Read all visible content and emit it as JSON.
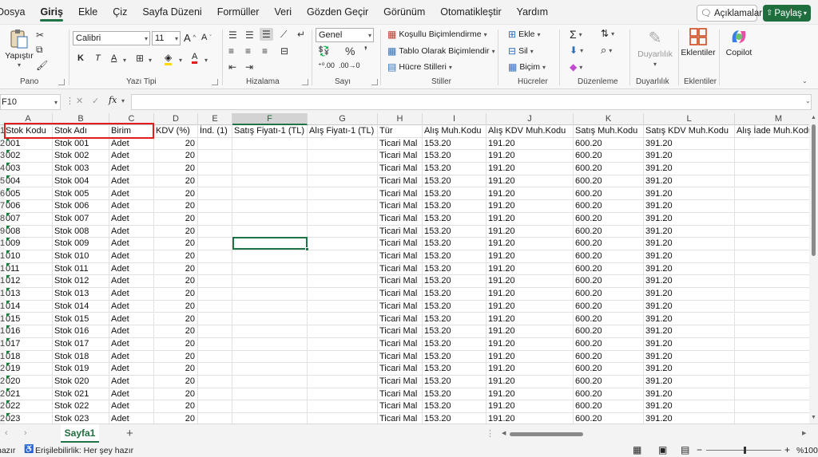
{
  "menu": {
    "items": [
      "Dosya",
      "Giriş",
      "Ekle",
      "Çiz",
      "Sayfa Düzeni",
      "Formüller",
      "Veri",
      "Gözden Geçir",
      "Görünüm",
      "Otomatikleştir",
      "Yardım"
    ],
    "active": "Giriş",
    "comments_label": "Açıklamalar",
    "share_label": "Paylaş"
  },
  "ribbon": {
    "clipboard": {
      "paste_label": "Yapıştır",
      "group_label": "Pano"
    },
    "font": {
      "font_name": "Calibri",
      "font_size": "11",
      "group_label": "Yazı Tipi",
      "bold": "K",
      "italic": "T",
      "underline": "A"
    },
    "alignment": {
      "group_label": "Hizalama"
    },
    "number": {
      "format": "Genel",
      "group_label": "Sayı"
    },
    "styles": {
      "conditional": "Koşullu Biçimlendirme",
      "as_table": "Tablo Olarak Biçimlendir",
      "cell_styles": "Hücre Stilleri",
      "group_label": "Stiller"
    },
    "cells": {
      "insert": "Ekle",
      "delete": "Sil",
      "format": "Biçim",
      "group_label": "Hücreler"
    },
    "editing": {
      "group_label": "Düzenleme"
    },
    "sensitivity": {
      "label": "Duyarlılık",
      "group_label": "Duyarlılık"
    },
    "addins": {
      "label": "Eklentiler",
      "group_label": "Eklentiler"
    },
    "copilot": {
      "label": "Copilot"
    }
  },
  "formula_bar": {
    "name_box": "F10",
    "fx": "fx",
    "value": ""
  },
  "columns": [
    {
      "letter": "A"
    },
    {
      "letter": "B"
    },
    {
      "letter": "C"
    },
    {
      "letter": "D"
    },
    {
      "letter": "E"
    },
    {
      "letter": "F"
    },
    {
      "letter": "G"
    },
    {
      "letter": "H"
    },
    {
      "letter": "I"
    },
    {
      "letter": "J"
    },
    {
      "letter": "K"
    },
    {
      "letter": "L"
    },
    {
      "letter": "M"
    }
  ],
  "selected_column": "F",
  "header_row": [
    "Stok Kodu",
    "Stok Adı",
    "Birim",
    "KDV (%)",
    "İnd. (1)",
    "Satış Fiyatı-1 (TL)",
    "Alış Fiyatı-1 (TL)",
    "Tür",
    "Alış Muh.Kodu",
    "Alış KDV Muh.Kodu",
    "Satış Muh.Kodu",
    "Satış KDV Muh.Kodu",
    "Alış İade Muh.Kodu"
  ],
  "row_numbers": [
    "1",
    "2",
    "3",
    "4",
    "5",
    "6",
    "7",
    "8",
    "9",
    "10",
    "11",
    "12",
    "13",
    "14",
    "15",
    "16",
    "17",
    "18",
    "19",
    "20",
    "21",
    "22",
    "23",
    "24"
  ],
  "rows": [
    [
      "001",
      "Stok 001",
      "Adet",
      "20",
      "",
      "",
      "",
      "Ticari Mal",
      "153.20",
      "191.20",
      "600.20",
      "391.20"
    ],
    [
      "002",
      "Stok 002",
      "Adet",
      "20",
      "",
      "",
      "",
      "Ticari Mal",
      "153.20",
      "191.20",
      "600.20",
      "391.20"
    ],
    [
      "003",
      "Stok 003",
      "Adet",
      "20",
      "",
      "",
      "",
      "Ticari Mal",
      "153.20",
      "191.20",
      "600.20",
      "391.20"
    ],
    [
      "004",
      "Stok 004",
      "Adet",
      "20",
      "",
      "",
      "",
      "Ticari Mal",
      "153.20",
      "191.20",
      "600.20",
      "391.20"
    ],
    [
      "005",
      "Stok 005",
      "Adet",
      "20",
      "",
      "",
      "",
      "Ticari Mal",
      "153.20",
      "191.20",
      "600.20",
      "391.20"
    ],
    [
      "006",
      "Stok 006",
      "Adet",
      "20",
      "",
      "",
      "",
      "Ticari Mal",
      "153.20",
      "191.20",
      "600.20",
      "391.20"
    ],
    [
      "007",
      "Stok 007",
      "Adet",
      "20",
      "",
      "",
      "",
      "Ticari Mal",
      "153.20",
      "191.20",
      "600.20",
      "391.20"
    ],
    [
      "008",
      "Stok 008",
      "Adet",
      "20",
      "",
      "",
      "",
      "Ticari Mal",
      "153.20",
      "191.20",
      "600.20",
      "391.20"
    ],
    [
      "009",
      "Stok 009",
      "Adet",
      "20",
      "",
      "",
      "",
      "Ticari Mal",
      "153.20",
      "191.20",
      "600.20",
      "391.20"
    ],
    [
      "010",
      "Stok 010",
      "Adet",
      "20",
      "",
      "",
      "",
      "Ticari Mal",
      "153.20",
      "191.20",
      "600.20",
      "391.20"
    ],
    [
      "011",
      "Stok 011",
      "Adet",
      "20",
      "",
      "",
      "",
      "Ticari Mal",
      "153.20",
      "191.20",
      "600.20",
      "391.20"
    ],
    [
      "012",
      "Stok 012",
      "Adet",
      "20",
      "",
      "",
      "",
      "Ticari Mal",
      "153.20",
      "191.20",
      "600.20",
      "391.20"
    ],
    [
      "013",
      "Stok 013",
      "Adet",
      "20",
      "",
      "",
      "",
      "Ticari Mal",
      "153.20",
      "191.20",
      "600.20",
      "391.20"
    ],
    [
      "014",
      "Stok 014",
      "Adet",
      "20",
      "",
      "",
      "",
      "Ticari Mal",
      "153.20",
      "191.20",
      "600.20",
      "391.20"
    ],
    [
      "015",
      "Stok 015",
      "Adet",
      "20",
      "",
      "",
      "",
      "Ticari Mal",
      "153.20",
      "191.20",
      "600.20",
      "391.20"
    ],
    [
      "016",
      "Stok 016",
      "Adet",
      "20",
      "",
      "",
      "",
      "Ticari Mal",
      "153.20",
      "191.20",
      "600.20",
      "391.20"
    ],
    [
      "017",
      "Stok 017",
      "Adet",
      "20",
      "",
      "",
      "",
      "Ticari Mal",
      "153.20",
      "191.20",
      "600.20",
      "391.20"
    ],
    [
      "018",
      "Stok 018",
      "Adet",
      "20",
      "",
      "",
      "",
      "Ticari Mal",
      "153.20",
      "191.20",
      "600.20",
      "391.20"
    ],
    [
      "019",
      "Stok 019",
      "Adet",
      "20",
      "",
      "",
      "",
      "Ticari Mal",
      "153.20",
      "191.20",
      "600.20",
      "391.20"
    ],
    [
      "020",
      "Stok 020",
      "Adet",
      "20",
      "",
      "",
      "",
      "Ticari Mal",
      "153.20",
      "191.20",
      "600.20",
      "391.20"
    ],
    [
      "021",
      "Stok 021",
      "Adet",
      "20",
      "",
      "",
      "",
      "Ticari Mal",
      "153.20",
      "191.20",
      "600.20",
      "391.20"
    ],
    [
      "022",
      "Stok 022",
      "Adet",
      "20",
      "",
      "",
      "",
      "Ticari Mal",
      "153.20",
      "191.20",
      "600.20",
      "391.20"
    ],
    [
      "023",
      "Stok 023",
      "Adet",
      "20",
      "",
      "",
      "",
      "Ticari Mal",
      "153.20",
      "191.20",
      "600.20",
      "391.20"
    ]
  ],
  "sheet_tabs": [
    {
      "label": "Sayfa1",
      "active": true
    }
  ],
  "status": {
    "ready": "hazır",
    "accessibility": "Erişilebilirlik: Her şey hazır",
    "zoom": "%100"
  },
  "colors": {
    "accent": "#217346",
    "highlight_box": "#e01c1c"
  }
}
